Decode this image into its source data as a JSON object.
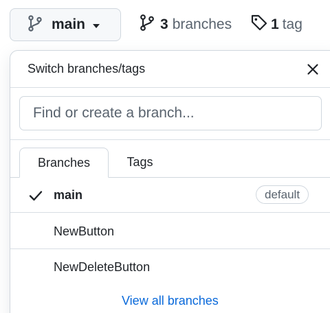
{
  "toolbar": {
    "current_branch": "main",
    "branches_count": "3",
    "branches_word": "branches",
    "tags_count": "1",
    "tags_word": "tag"
  },
  "panel": {
    "title": "Switch branches/tags",
    "filter_placeholder": "Find or create a branch...",
    "tabs": [
      {
        "label": "Branches",
        "selected": true
      },
      {
        "label": "Tags",
        "selected": false
      }
    ],
    "branches": [
      {
        "name": "main",
        "checked": true,
        "badge": "default"
      },
      {
        "name": "NewButton",
        "checked": false,
        "badge": ""
      },
      {
        "name": "NewDeleteButton",
        "checked": false,
        "badge": ""
      }
    ],
    "view_all": "View all branches"
  },
  "icons": {
    "branch": "git-branch-icon",
    "tag": "tag-icon",
    "close": "x-icon",
    "check": "check-icon",
    "caret": "triangle-down-icon"
  },
  "colors": {
    "link": "#0969da",
    "border": "#d0d7de",
    "muted": "#59636e",
    "button_bg": "#f6f8fa"
  }
}
